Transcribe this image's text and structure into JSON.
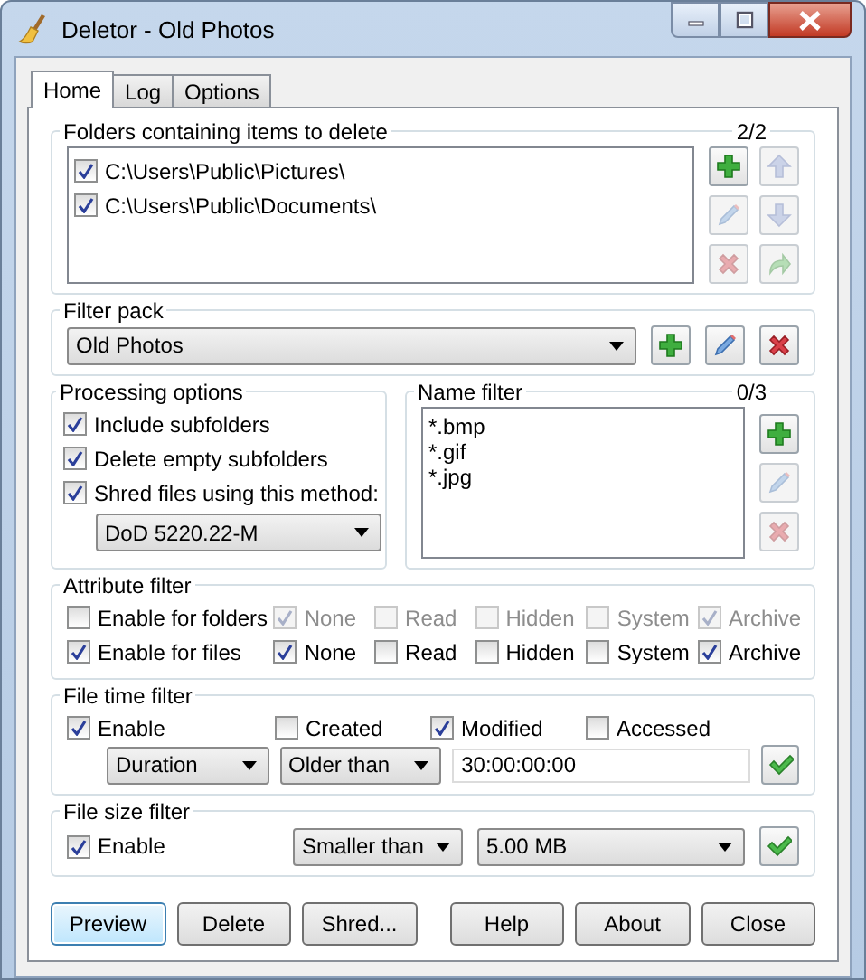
{
  "window": {
    "title": "Deletor - Old Photos"
  },
  "tabs": [
    {
      "label": "Home",
      "selected": true
    },
    {
      "label": "Log",
      "selected": false
    },
    {
      "label": "Options",
      "selected": false
    }
  ],
  "folders": {
    "title": "Folders containing items to delete",
    "count": "2/2",
    "items": [
      {
        "path": "C:\\Users\\Public\\Pictures\\",
        "checked": true
      },
      {
        "path": "C:\\Users\\Public\\Documents\\",
        "checked": true
      }
    ],
    "buttons": [
      {
        "kind": "add",
        "disabled": false
      },
      {
        "kind": "up",
        "disabled": true
      },
      {
        "kind": "edit",
        "disabled": true
      },
      {
        "kind": "down",
        "disabled": true
      },
      {
        "kind": "remove",
        "disabled": true
      },
      {
        "kind": "export",
        "disabled": true
      }
    ]
  },
  "filter_pack": {
    "title": "Filter pack",
    "value": "Old Photos",
    "buttons": [
      {
        "kind": "add",
        "disabled": false
      },
      {
        "kind": "edit",
        "disabled": false
      },
      {
        "kind": "remove",
        "disabled": false
      }
    ]
  },
  "processing": {
    "title": "Processing options",
    "options": [
      {
        "label": "Include subfolders",
        "checked": true
      },
      {
        "label": "Delete empty subfolders",
        "checked": true
      },
      {
        "label": "Shred files using this method:",
        "checked": true
      }
    ],
    "method": "DoD 5220.22-M"
  },
  "name_filter": {
    "title": "Name filter",
    "count": "0/3",
    "items": [
      "*.bmp",
      "*.gif",
      "*.jpg"
    ],
    "buttons": [
      {
        "kind": "add",
        "disabled": false
      },
      {
        "kind": "edit",
        "disabled": true
      },
      {
        "kind": "remove",
        "disabled": true
      }
    ]
  },
  "attribute_filter": {
    "title": "Attribute filter",
    "rows": [
      {
        "label": "Enable for folders",
        "checked": false,
        "attributes": [
          {
            "label": "None",
            "checked": true,
            "disabled": true
          },
          {
            "label": "Read",
            "checked": false,
            "disabled": true
          },
          {
            "label": "Hidden",
            "checked": false,
            "disabled": true
          },
          {
            "label": "System",
            "checked": false,
            "disabled": true
          },
          {
            "label": "Archive",
            "checked": true,
            "disabled": true
          }
        ]
      },
      {
        "label": "Enable for files",
        "checked": true,
        "attributes": [
          {
            "label": "None",
            "checked": true,
            "disabled": false
          },
          {
            "label": "Read",
            "checked": false,
            "disabled": false
          },
          {
            "label": "Hidden",
            "checked": false,
            "disabled": false
          },
          {
            "label": "System",
            "checked": false,
            "disabled": false
          },
          {
            "label": "Archive",
            "checked": true,
            "disabled": false
          }
        ]
      }
    ]
  },
  "file_time_filter": {
    "title": "File time filter",
    "enable": {
      "label": "Enable",
      "checked": true
    },
    "fields": [
      {
        "label": "Created",
        "checked": false
      },
      {
        "label": "Modified",
        "checked": true
      },
      {
        "label": "Accessed",
        "checked": false
      }
    ],
    "type": "Duration",
    "comparison": "Older than",
    "value": "30:00:00:00"
  },
  "file_size_filter": {
    "title": "File size filter",
    "enable": {
      "label": "Enable",
      "checked": true
    },
    "comparison": "Smaller than",
    "value": "5.00 MB"
  },
  "buttons": [
    {
      "label": "Preview",
      "focused": true
    },
    {
      "label": "Delete",
      "focused": false
    },
    {
      "label": "Shred...",
      "focused": false
    },
    {
      "label": "Help",
      "focused": false
    },
    {
      "label": "About",
      "focused": false
    },
    {
      "label": "Close",
      "focused": false
    }
  ]
}
